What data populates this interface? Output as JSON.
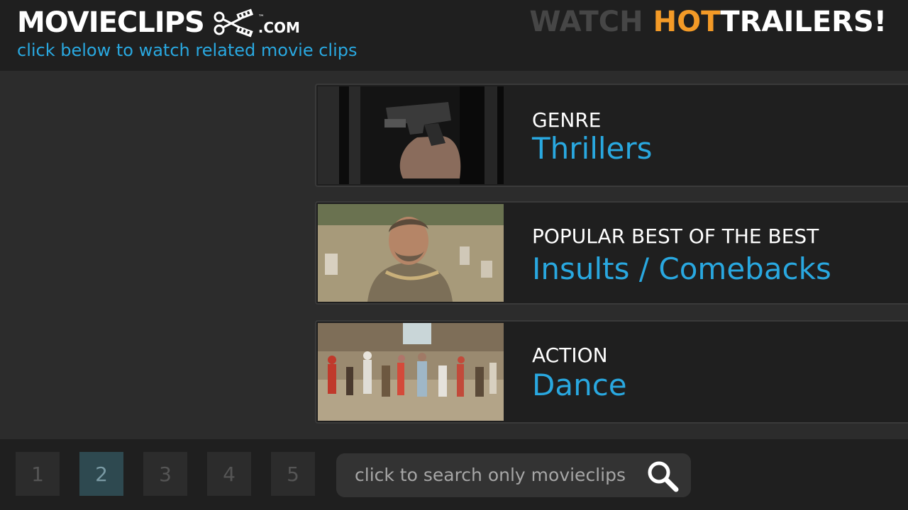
{
  "header": {
    "logo_text": "MOVIECLIPS",
    "logo_tld": ".COM",
    "logo_tm": "™",
    "tagline": "click below to watch related movie clips",
    "promo_watch": "WATCH",
    "promo_hot": "HOT",
    "promo_trailers": "TRAILERS!"
  },
  "colors": {
    "accent_blue": "#29a8e0",
    "accent_orange": "#f39a27",
    "background": "#2c2c2c",
    "bar": "#1f1f1f"
  },
  "cards": [
    {
      "category": "GENRE",
      "title": "Thrillers",
      "thumb_icon": "gun-scene-thumbnail"
    },
    {
      "category": "POPULAR BEST OF THE BEST",
      "title": "Insults / Comebacks",
      "thumb_icon": "western-man-thumbnail"
    },
    {
      "category": "ACTION",
      "title": "Dance",
      "thumb_icon": "crowd-dance-thumbnail"
    }
  ],
  "pagination": {
    "pages": [
      "1",
      "2",
      "3",
      "4",
      "5"
    ],
    "active_page": "2"
  },
  "search": {
    "placeholder": "click to search only movieclips",
    "icon": "search-icon"
  }
}
